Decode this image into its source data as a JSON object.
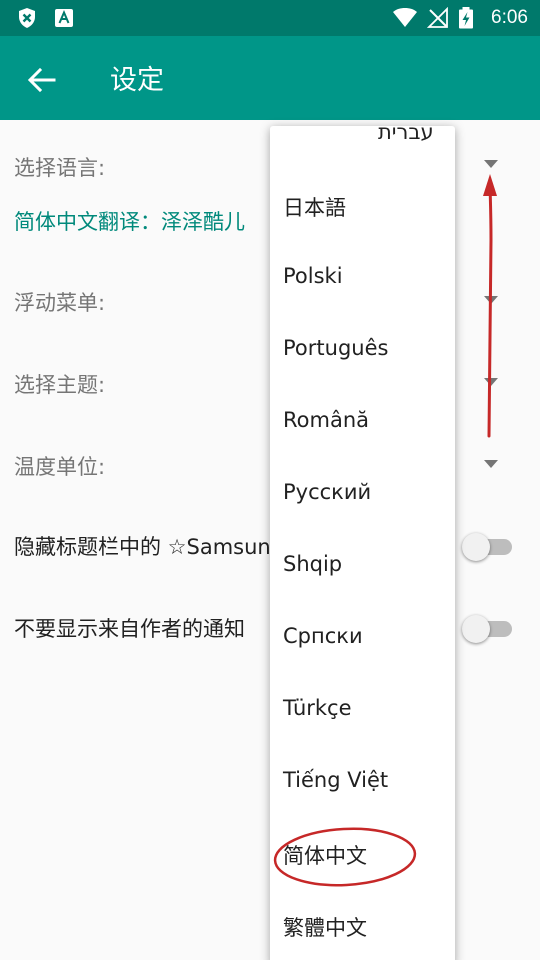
{
  "status_bar": {
    "time": "6:06",
    "icons": [
      "close-shield-icon",
      "text-a-icon",
      "wifi-icon",
      "no-signal-icon",
      "battery-charging-icon"
    ]
  },
  "toolbar": {
    "back_icon": "arrow-back-icon",
    "title": "设定"
  },
  "settings": {
    "language": {
      "label": "选择语言:",
      "value": "简体中文翻译：泽泽酷儿"
    },
    "floating_menu": {
      "label": "浮动菜单:"
    },
    "theme": {
      "label": "选择主题:"
    },
    "temperature_unit": {
      "label": "温度单位:"
    },
    "hide_title": {
      "label": "隐藏标题栏中的 ☆Samsung",
      "enabled": false
    },
    "no_author_notice": {
      "label": "不要显示来自作者的通知",
      "enabled": false
    }
  },
  "language_dropdown": {
    "items": [
      "עברית",
      "日本語",
      "Polski",
      "Português",
      "Română",
      "Русский",
      "Shqip",
      "Српски",
      "Türkçe",
      "Tiếng Việt",
      "简体中文",
      "繁體中文"
    ],
    "highlighted": "简体中文"
  },
  "annotation_colors": {
    "arrow": "#c62828",
    "ellipse": "#c62828"
  },
  "colors": {
    "status_bar": "#00796b",
    "toolbar": "#009688",
    "accent_text": "#00897b"
  }
}
